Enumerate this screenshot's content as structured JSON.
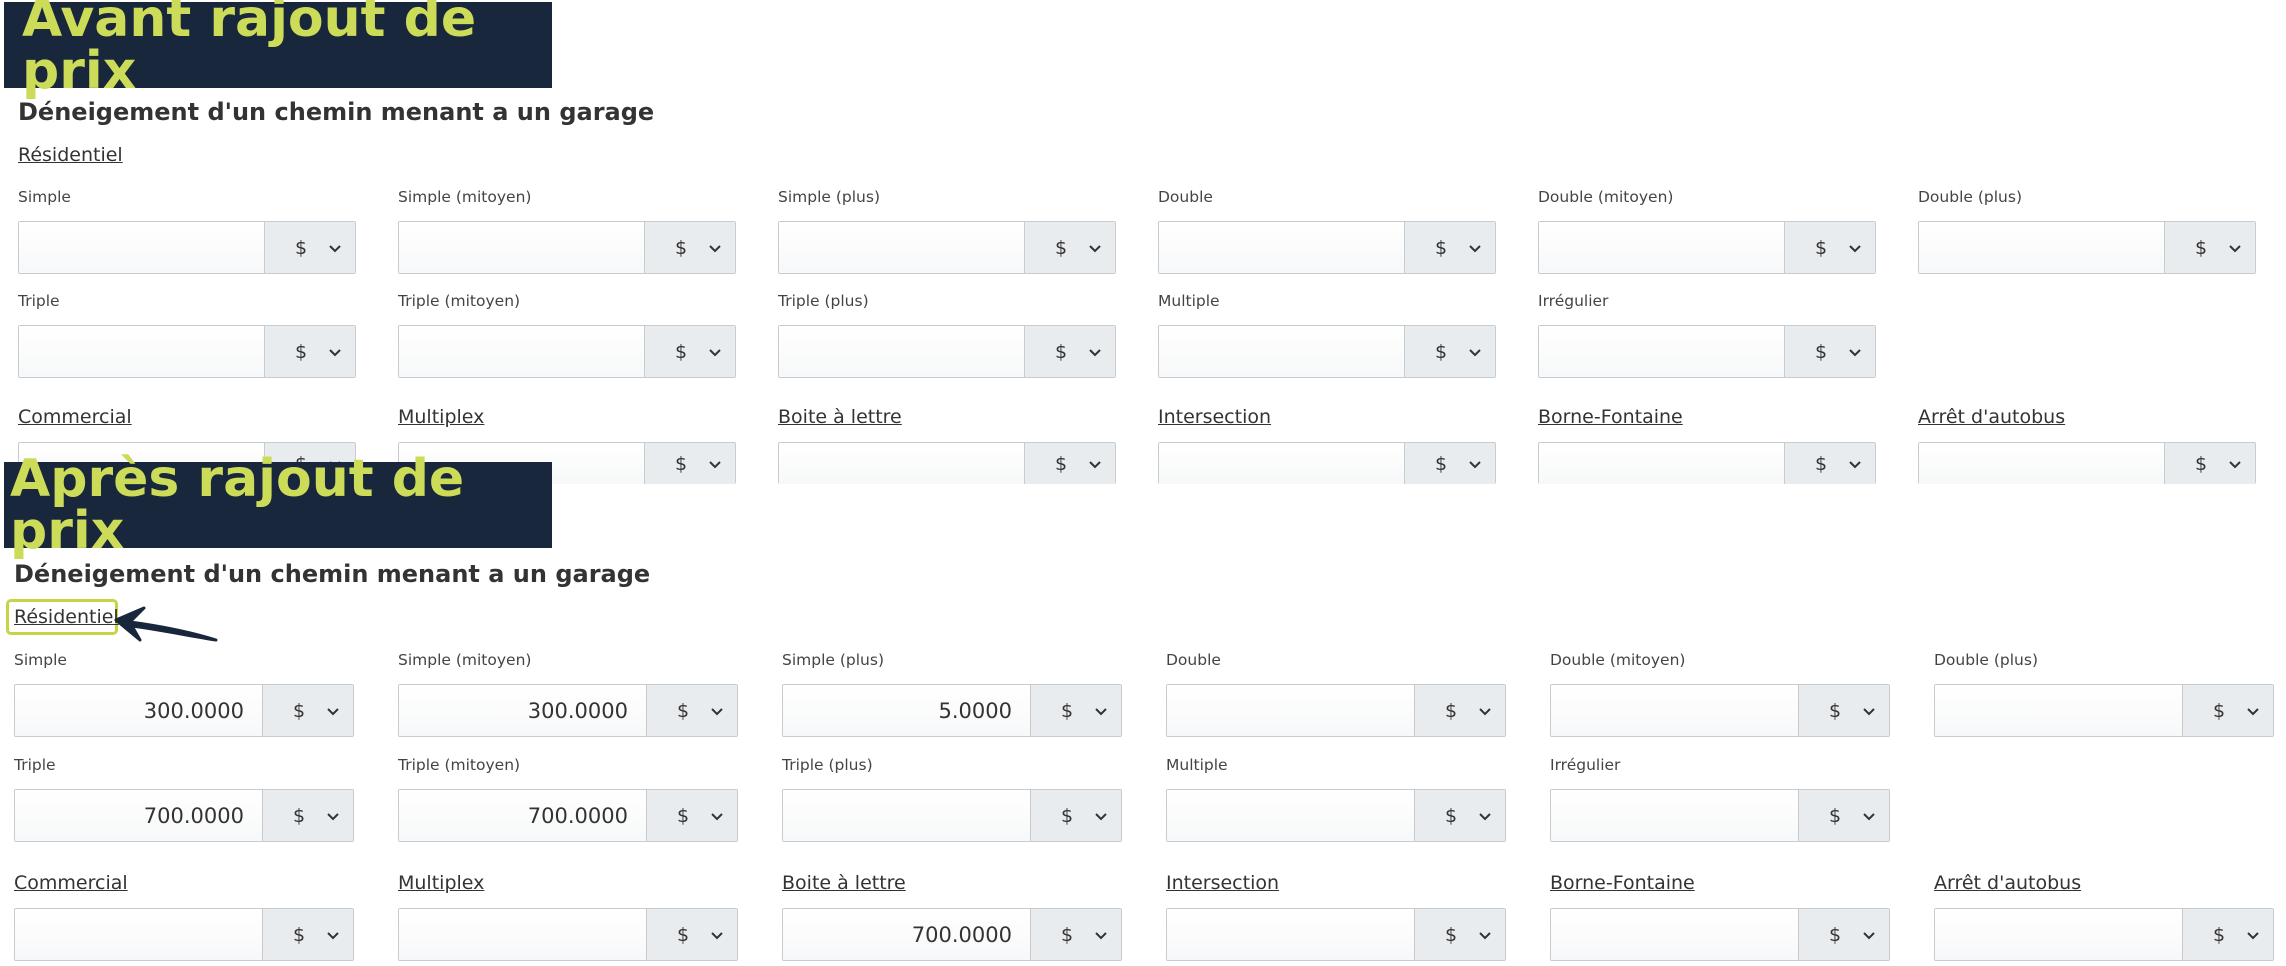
{
  "before": {
    "banner": "Avant rajout de prix",
    "title": "Déneigement d'un chemin menant a un garage",
    "section": "Résidentiel",
    "row1": [
      {
        "label": "Simple",
        "value": "",
        "currency": "$"
      },
      {
        "label": "Simple (mitoyen)",
        "value": "",
        "currency": "$"
      },
      {
        "label": "Simple (plus)",
        "value": "",
        "currency": "$"
      },
      {
        "label": "Double",
        "value": "",
        "currency": "$"
      },
      {
        "label": "Double (mitoyen)",
        "value": "",
        "currency": "$"
      },
      {
        "label": "Double (plus)",
        "value": "",
        "currency": "$"
      }
    ],
    "row2": [
      {
        "label": "Triple",
        "value": "",
        "currency": "$"
      },
      {
        "label": "Triple (mitoyen)",
        "value": "",
        "currency": "$"
      },
      {
        "label": "Triple (plus)",
        "value": "",
        "currency": "$"
      },
      {
        "label": "Multiple",
        "value": "",
        "currency": "$"
      },
      {
        "label": "Irrégulier",
        "value": "",
        "currency": "$"
      }
    ],
    "row3": [
      {
        "label": "Commercial",
        "value": "",
        "currency": "$"
      },
      {
        "label": "Multiplex",
        "value": "",
        "currency": "$"
      },
      {
        "label": "Boite à lettre",
        "value": "",
        "currency": "$"
      },
      {
        "label": "Intersection",
        "value": "",
        "currency": "$"
      },
      {
        "label": "Borne-Fontaine",
        "value": "",
        "currency": "$"
      },
      {
        "label": "Arrêt d'autobus",
        "value": "",
        "currency": "$"
      }
    ]
  },
  "after": {
    "banner": "Après rajout de prix",
    "title": "Déneigement d'un chemin menant a un garage",
    "section": "Résidentiel",
    "row1": [
      {
        "label": "Simple",
        "value": "300.0000",
        "currency": "$"
      },
      {
        "label": "Simple (mitoyen)",
        "value": "300.0000",
        "currency": "$"
      },
      {
        "label": "Simple (plus)",
        "value": "5.0000",
        "currency": "$"
      },
      {
        "label": "Double",
        "value": "",
        "currency": "$"
      },
      {
        "label": "Double (mitoyen)",
        "value": "",
        "currency": "$"
      },
      {
        "label": "Double (plus)",
        "value": "",
        "currency": "$"
      }
    ],
    "row2": [
      {
        "label": "Triple",
        "value": "700.0000",
        "currency": "$"
      },
      {
        "label": "Triple (mitoyen)",
        "value": "700.0000",
        "currency": "$"
      },
      {
        "label": "Triple (plus)",
        "value": "",
        "currency": "$"
      },
      {
        "label": "Multiple",
        "value": "",
        "currency": "$"
      },
      {
        "label": "Irrégulier",
        "value": "",
        "currency": "$"
      }
    ],
    "row3": [
      {
        "label": "Commercial",
        "value": "",
        "currency": "$"
      },
      {
        "label": "Multiplex",
        "value": "",
        "currency": "$"
      },
      {
        "label": "Boite à lettre",
        "value": "700.0000",
        "currency": "$"
      },
      {
        "label": "Intersection",
        "value": "",
        "currency": "$"
      },
      {
        "label": "Borne-Fontaine",
        "value": "",
        "currency": "$"
      },
      {
        "label": "Arrêt d'autobus",
        "value": "",
        "currency": "$"
      }
    ]
  },
  "colors": {
    "banner_bg": "#18273b",
    "banner_text": "#cddc58",
    "highlight": "#c6d544",
    "arrow": "#18273b"
  },
  "icons": {
    "dropdown": "chevron-down-icon",
    "annotation": "arrow-left-icon"
  }
}
